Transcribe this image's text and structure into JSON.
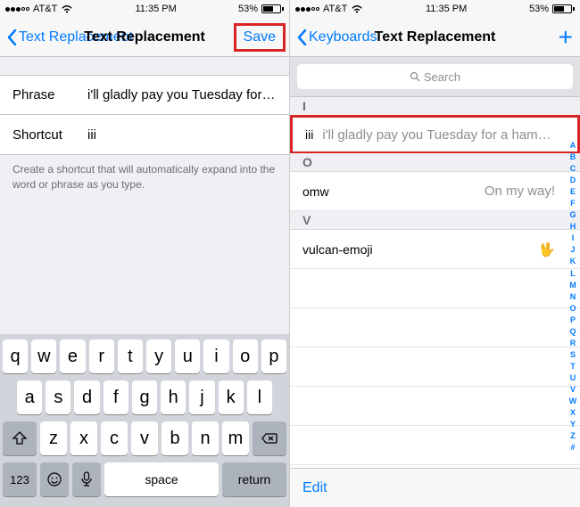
{
  "status": {
    "carrier": "AT&T",
    "time": "11:35 PM",
    "battery_pct": "53%"
  },
  "left": {
    "back_label": "Text Replacement",
    "title": "Text Replacement",
    "save_label": "Save",
    "phrase_label": "Phrase",
    "phrase_value": "i'll gladly pay you Tuesday for a ham...",
    "shortcut_label": "Shortcut",
    "shortcut_value": "iii",
    "hint": "Create a shortcut that will automatically expand into the word or phrase as you type."
  },
  "right": {
    "back_label": "Keyboards",
    "title": "Text Replacement",
    "search_placeholder": "Search",
    "edit_label": "Edit",
    "sections": {
      "I": {
        "shortcut": "iii",
        "phrase": "i'll gladly pay you Tuesday for a hambu..."
      },
      "O": {
        "shortcut": "omw",
        "phrase": "On my way!"
      },
      "V": {
        "shortcut": "vulcan-emoji",
        "phrase": "🖖"
      }
    },
    "index": [
      "A",
      "B",
      "C",
      "D",
      "E",
      "F",
      "G",
      "H",
      "I",
      "J",
      "K",
      "L",
      "M",
      "N",
      "O",
      "P",
      "Q",
      "R",
      "S",
      "T",
      "U",
      "V",
      "W",
      "X",
      "Y",
      "Z",
      "#"
    ]
  },
  "keyboard": {
    "row1": [
      "q",
      "w",
      "e",
      "r",
      "t",
      "y",
      "u",
      "i",
      "o",
      "p"
    ],
    "row2": [
      "a",
      "s",
      "d",
      "f",
      "g",
      "h",
      "j",
      "k",
      "l"
    ],
    "row3": [
      "z",
      "x",
      "c",
      "v",
      "b",
      "n",
      "m"
    ],
    "num_key": "123",
    "space": "space",
    "return": "return"
  }
}
